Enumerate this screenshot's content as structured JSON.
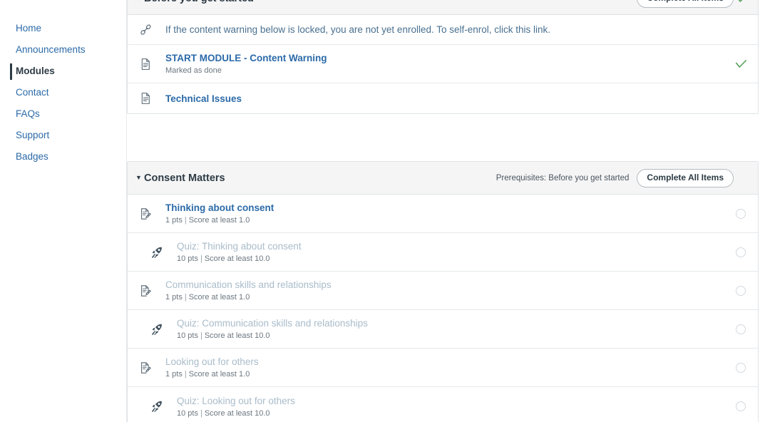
{
  "sidebar": {
    "items": [
      {
        "label": "Home",
        "active": false
      },
      {
        "label": "Announcements",
        "active": false
      },
      {
        "label": "Modules",
        "active": true
      },
      {
        "label": "Contact",
        "active": false
      },
      {
        "label": "FAQs",
        "active": false
      },
      {
        "label": "Support",
        "active": false
      },
      {
        "label": "Badges",
        "active": false
      }
    ]
  },
  "modules": [
    {
      "title": "Before you get started",
      "collapse_icon": "triangle-down-icon",
      "prerequisites": "",
      "complete_all_label": "Complete All Items",
      "completed": true,
      "items": [
        {
          "title": "If the content warning below is locked, you are not yet enrolled. To self-enrol, click this link.",
          "icon": "link-icon",
          "style": "plain",
          "indent": 0,
          "subtitle": "",
          "points": "",
          "requirement": "",
          "status": "none"
        },
        {
          "title": "START MODULE - Content Warning",
          "icon": "document-icon",
          "style": "link",
          "indent": 0,
          "subtitle": "Marked as done",
          "points": "",
          "requirement": "",
          "status": "complete"
        },
        {
          "title": "Technical Issues",
          "icon": "document-icon",
          "style": "link",
          "indent": 0,
          "subtitle": "",
          "points": "",
          "requirement": "",
          "status": "none"
        }
      ]
    },
    {
      "title": "Consent Matters",
      "collapse_icon": "triangle-down-icon",
      "prerequisites": "Prerequisites: Before you get started",
      "complete_all_label": "Complete All Items",
      "completed": false,
      "items": [
        {
          "title": "Thinking about consent",
          "icon": "assignment-icon",
          "style": "link",
          "indent": 0,
          "subtitle": "",
          "points": "1 pts",
          "requirement": "Score at least 1.0",
          "status": "incomplete"
        },
        {
          "title": "Quiz: Thinking about consent",
          "icon": "rocket-icon",
          "style": "locked",
          "indent": 1,
          "subtitle": "",
          "points": "10 pts",
          "requirement": "Score at least 10.0",
          "status": "incomplete"
        },
        {
          "title": "Communication skills and relationships",
          "icon": "assignment-icon",
          "style": "locked",
          "indent": 0,
          "subtitle": "",
          "points": "1 pts",
          "requirement": "Score at least 1.0",
          "status": "incomplete"
        },
        {
          "title": "Quiz: Communication skills and relationships",
          "icon": "rocket-icon",
          "style": "locked",
          "indent": 1,
          "subtitle": "",
          "points": "10 pts",
          "requirement": "Score at least 10.0",
          "status": "incomplete"
        },
        {
          "title": "Looking out for others",
          "icon": "assignment-icon",
          "style": "locked",
          "indent": 0,
          "subtitle": "",
          "points": "1 pts",
          "requirement": "Score at least 1.0",
          "status": "incomplete"
        },
        {
          "title": "Quiz: Looking out for others",
          "icon": "rocket-icon",
          "style": "locked",
          "indent": 1,
          "subtitle": "",
          "points": "10 pts",
          "requirement": "Score at least 10.0",
          "status": "incomplete"
        }
      ]
    }
  ],
  "colors": {
    "link": "#2b6aa8",
    "locked": "#a9bcca",
    "header_bg": "#f5f5f5",
    "check_green": "#4e9c52",
    "active_nav": "#2d3b45"
  }
}
